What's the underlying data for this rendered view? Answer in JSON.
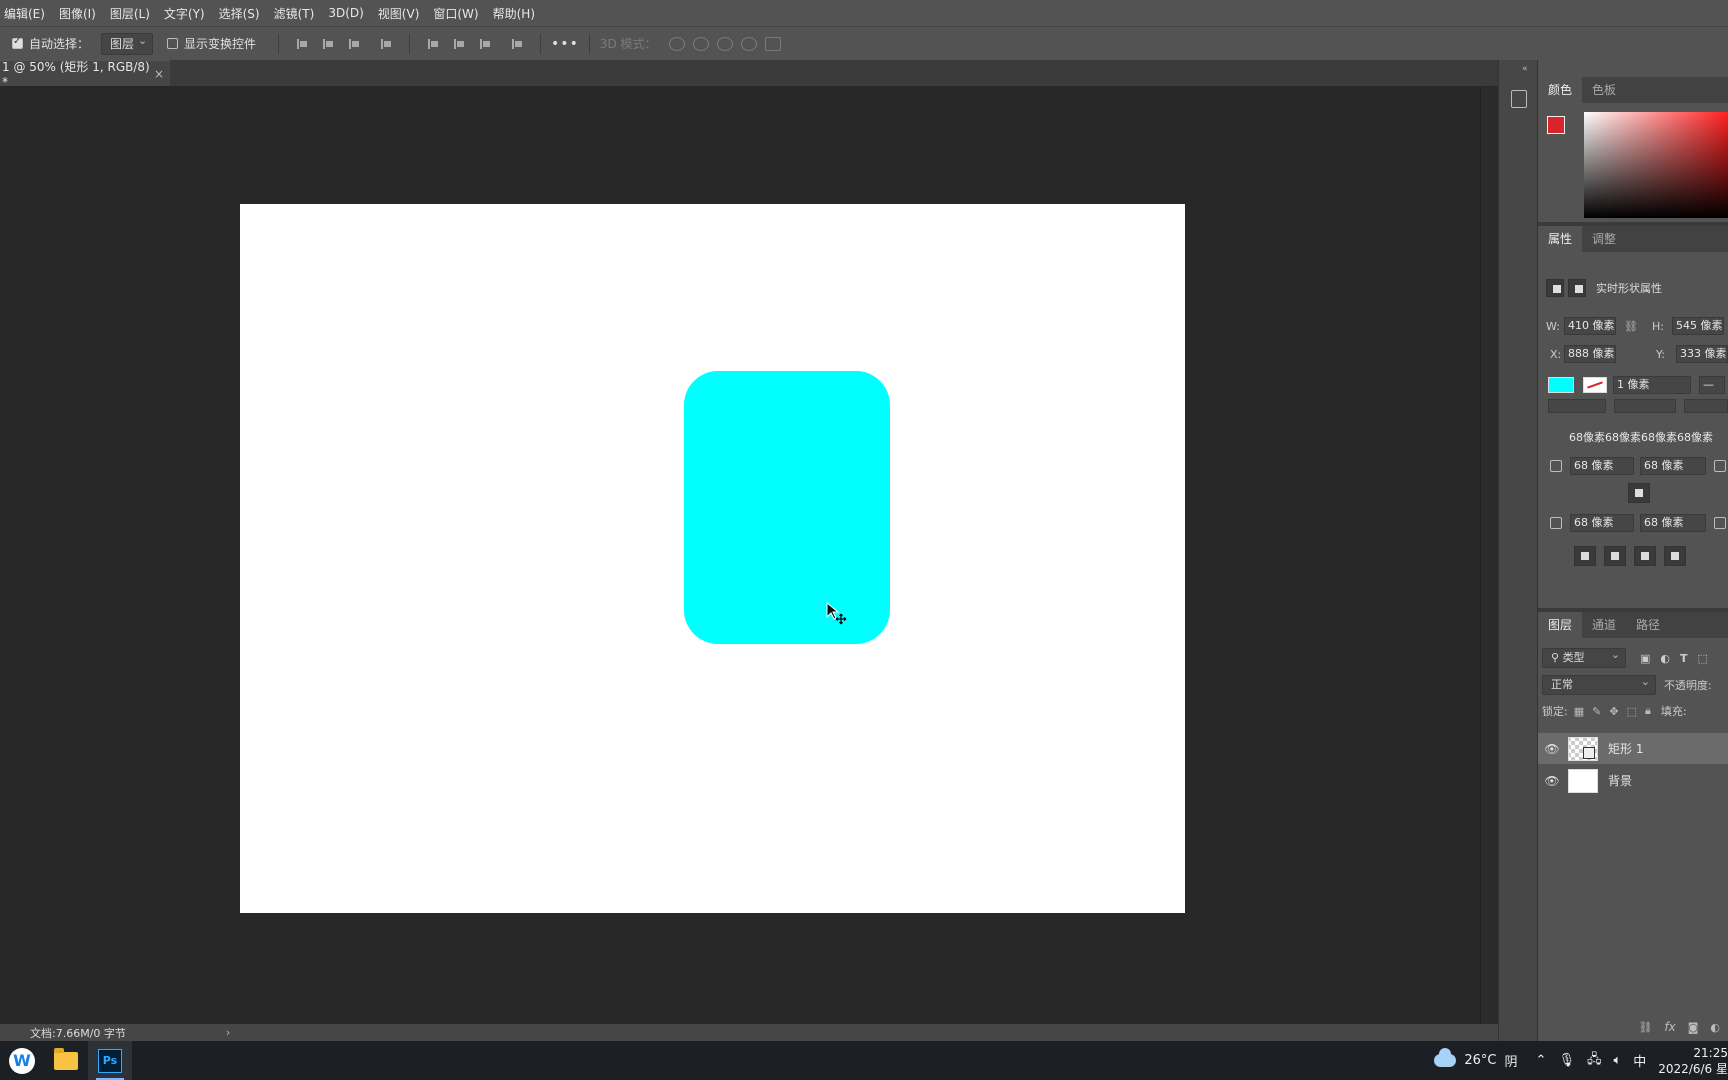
{
  "menu": [
    "编辑(E)",
    "图像(I)",
    "图层(L)",
    "文字(Y)",
    "选择(S)",
    "滤镜(T)",
    "3D(D)",
    "视图(V)",
    "窗口(W)",
    "帮助(H)"
  ],
  "options": {
    "auto_select_label": "自动选择：",
    "auto_select_value": "图层",
    "show_transform_label": "显示变换控件",
    "mode_3d_label": "3D 模式："
  },
  "document": {
    "tab_title": "1 @ 50% (矩形 1, RGB/8) *",
    "tab_close": "×",
    "shape_color": "#00ffff",
    "status_text": "文档:7.66M/0 字节",
    "status_arrow": "›"
  },
  "color_panel": {
    "tabs": [
      "颜色",
      "色板"
    ],
    "foreground": "#d8242b",
    "background": "#ffffff"
  },
  "properties_panel": {
    "tabs": [
      "属性",
      "调整"
    ],
    "title": "实时形状属性",
    "w_label": "W:",
    "w_value": "410 像素",
    "h_label": "H:",
    "h_value": "545 像素",
    "x_label": "X:",
    "x_value": "888 像素",
    "y_label": "Y:",
    "y_value": "333 像素",
    "stroke_width": "1 像素",
    "corner_all": "68像素68像素68像素68像素",
    "corner_tl": "68 像素",
    "corner_tr": "68 像素",
    "corner_bl": "68 像素",
    "corner_br": "68 像素"
  },
  "layers_panel": {
    "tabs": [
      "图层",
      "通道",
      "路径"
    ],
    "filter_label": "类型",
    "blend_mode": "正常",
    "opacity_label": "不透明度:",
    "lock_label": "锁定:",
    "fill_label": "填充:",
    "layers": [
      {
        "name": "矩形 1",
        "selected": true
      },
      {
        "name": "背景",
        "selected": false
      }
    ],
    "fx_label": "fx"
  },
  "taskbar": {
    "weather_temp": "26°C",
    "weather_desc": "阴",
    "ime": "中",
    "time": "21:25",
    "date": "2022/6/6 星"
  }
}
